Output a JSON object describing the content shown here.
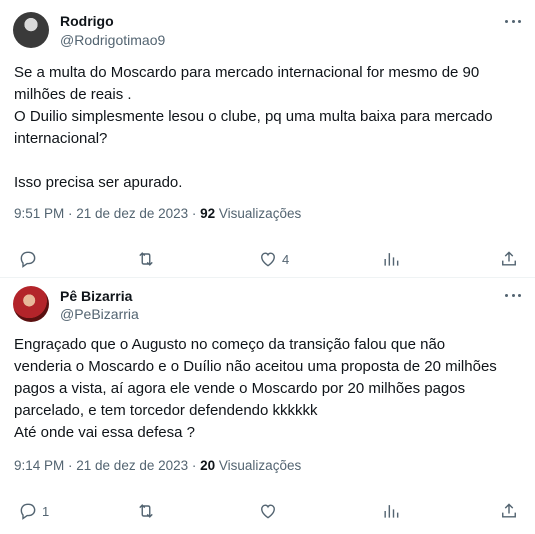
{
  "tweets": [
    {
      "name": "Rodrigo",
      "handle": "@Rodrigotimao9",
      "text": "Se a multa do Moscardo para mercado internacional for mesmo de 90\nmilhões de reais .\nO Duilio simplesmente lesou o clube, pq uma multa baixa para mercado\ninternacional?\n\nIsso precisa ser apurado.",
      "time": "9:51 PM · 21 de dez de 2023 · ",
      "views_count": "92",
      "views_label": " Visualizações",
      "reply_count": "",
      "retweet_count": "",
      "like_count": "4"
    },
    {
      "name": "Pê Bizarria",
      "handle": "@PeBizarria",
      "text": "Engraçado que o Augusto no começo da transição falou que não\nvenderia o Moscardo e o Duílio não aceitou uma proposta de 20 milhões\npagos a vista, aí agora ele vende o Moscardo por 20 milhões pagos\nparcelado, e tem torcedor defendendo kkkkkk\nAté onde vai essa defesa ?",
      "time": "9:14 PM · 21 de dez de 2023 · ",
      "views_count": "20",
      "views_label": " Visualizações",
      "reply_count": "1",
      "retweet_count": "",
      "like_count": ""
    }
  ],
  "icons": {
    "reply": "reply-icon",
    "retweet": "retweet-icon",
    "like": "heart-icon",
    "stats": "stats-icon",
    "share": "share-icon",
    "more": "more-icon"
  },
  "colors": {
    "text": "#0f1419",
    "secondary": "#536471",
    "divider": "#eff3f4"
  }
}
